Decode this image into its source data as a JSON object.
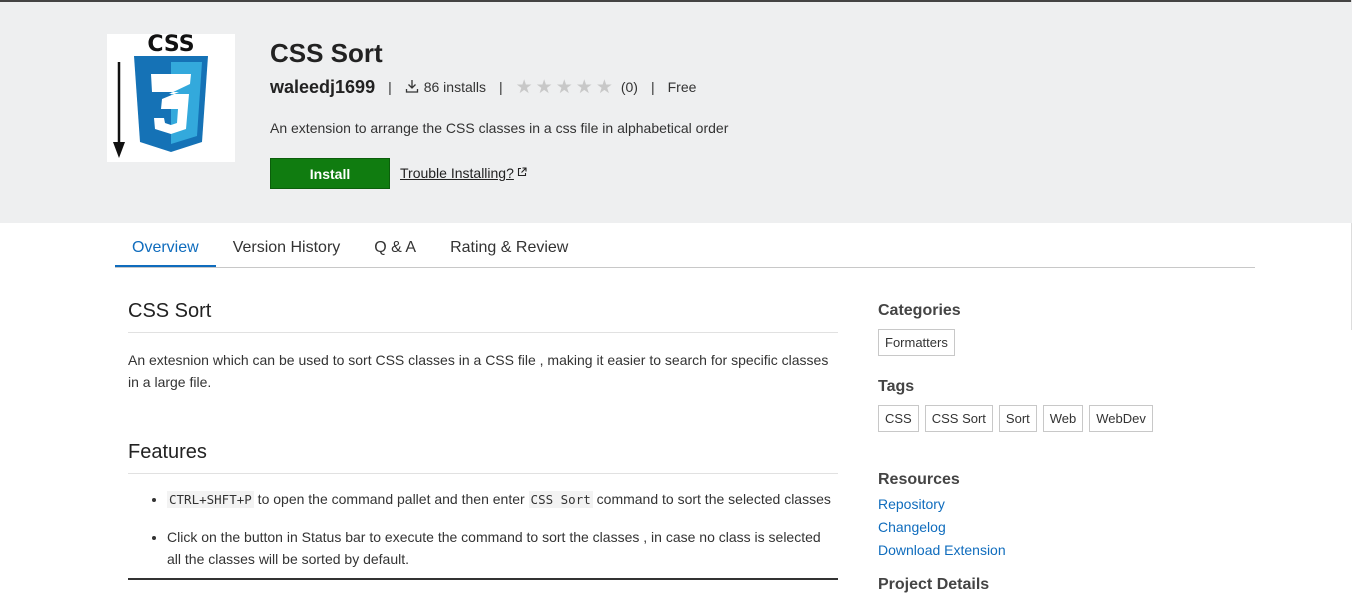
{
  "header": {
    "title": "CSS Sort",
    "publisher": "waleedj1699",
    "installs": "86 installs",
    "rating_count": "(0)",
    "price": "Free",
    "description": "An extension to arrange the CSS classes in a css file in alphabetical order",
    "install_label": "Install",
    "trouble_label": "Trouble Installing?",
    "logo_text": "CSS",
    "stars": 0
  },
  "tabs": [
    "Overview",
    "Version History",
    "Q & A",
    "Rating & Review"
  ],
  "main": {
    "heading": "CSS Sort",
    "intro": "An extesnion which can be used to sort CSS classes in a CSS file , making it easier to search for specific classes in a large file.",
    "features_heading": "Features",
    "feature1_key": "CTRL+SHFT+P",
    "feature1_mid": " to open the command pallet and then enter ",
    "feature1_cmd": "CSS Sort",
    "feature1_end": " command to sort the selected classes",
    "feature2": "Click on the button in Status bar to execute the command to sort the classes , in case no class is selected all the classes will be sorted by default."
  },
  "sidebar": {
    "categories_heading": "Categories",
    "categories": [
      "Formatters"
    ],
    "tags_heading": "Tags",
    "tags": [
      "CSS",
      "CSS Sort",
      "Sort",
      "Web",
      "WebDev"
    ],
    "resources_heading": "Resources",
    "resources": [
      "Repository",
      "Changelog",
      "Download Extension"
    ],
    "project_details_heading": "Project Details"
  },
  "colors": {
    "accent": "#0f6cbd",
    "install_green": "#107c10",
    "header_bg": "#eeeff0",
    "logo_blue": "#1572b6"
  }
}
